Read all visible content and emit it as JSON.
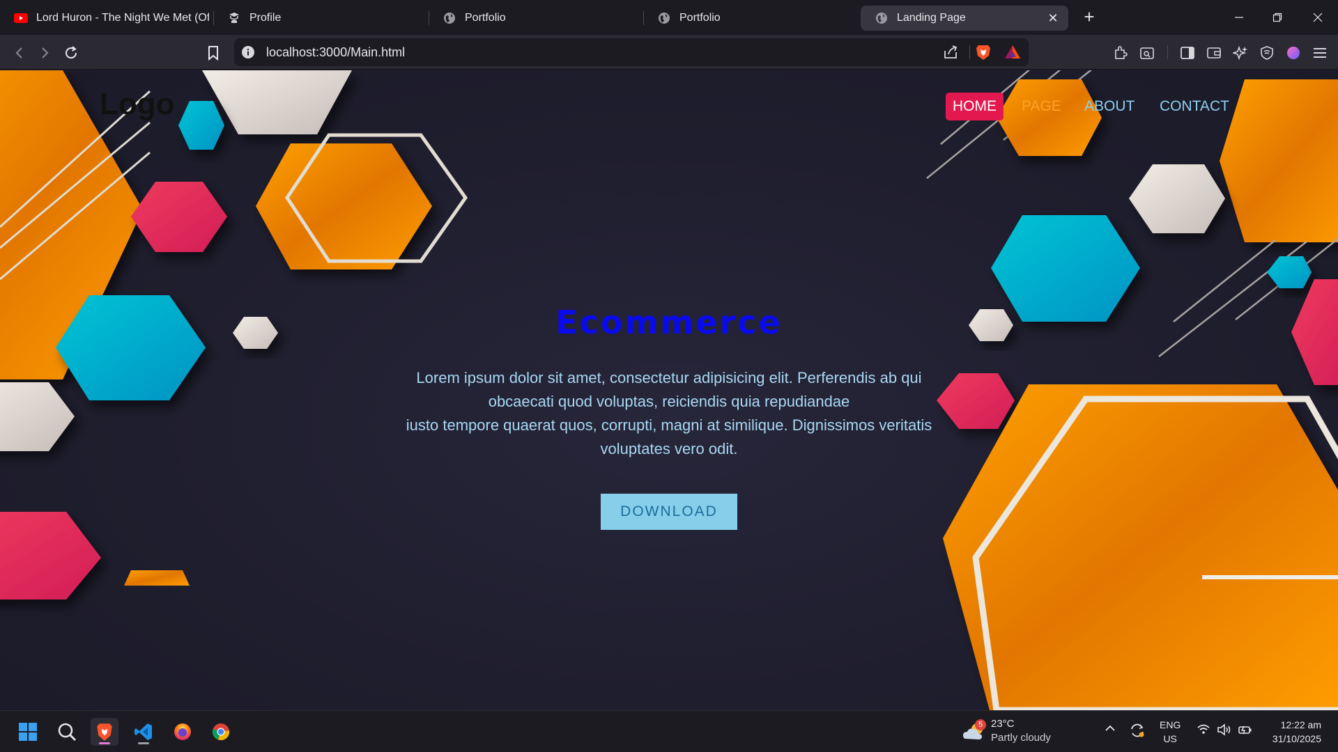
{
  "browser": {
    "tabs": [
      {
        "title": "Lord Huron - The Night We Met (Offi",
        "icon": "youtube-icon"
      },
      {
        "title": "Profile",
        "icon": "profile-icon"
      },
      {
        "title": "Portfolio",
        "icon": "globe-icon"
      },
      {
        "title": "Portfolio",
        "icon": "globe-icon"
      },
      {
        "title": "Landing Page",
        "icon": "globe-icon",
        "active": true
      }
    ],
    "url": "localhost:3000/Main.html"
  },
  "site": {
    "logo": "Logo",
    "nav": {
      "home": "HOME",
      "page": "PAGE",
      "about": "ABOUT",
      "contact": "CONTACT"
    },
    "hero": {
      "title": "Ecommerce",
      "line1": "Lorem ipsum dolor sit amet, consectetur adipisicing elit. Perferendis ab qui obcaecati quod voluptas, reiciendis quia repudiandae",
      "line2": "iusto tempore quaerat quos, corrupti, magni at similique. Dignissimos veritatis voluptates vero odit.",
      "button": "DOWNLOAD"
    },
    "colors": {
      "orange": "#ff9d00",
      "cyan": "#00bcd4",
      "pink": "#e8305a",
      "cream": "#e8e2da",
      "title_blue": "#0a0aee"
    }
  },
  "taskbar": {
    "weather": {
      "temp": "23°C",
      "desc": "Partly cloudy",
      "badge": "5"
    },
    "lang": {
      "line1": "ENG",
      "line2": "US"
    },
    "clock": {
      "time": "12:22 am",
      "date": "31/10/2025"
    }
  }
}
